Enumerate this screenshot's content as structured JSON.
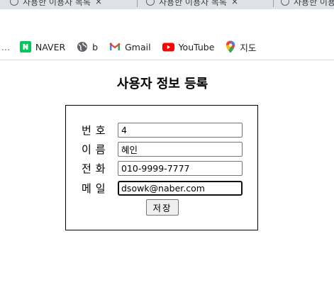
{
  "browser": {
    "tabs": [
      {
        "title": "사용한 이용자 목록"
      },
      {
        "title": "사용한 이용자 목록"
      },
      {
        "title": "사용한 이용자 목록"
      }
    ],
    "tab_close_glyph": "×",
    "bookmarks_overflow": "...",
    "bookmarks": [
      {
        "label": "NAVER",
        "icon": "naver-icon"
      },
      {
        "label": "b",
        "icon": "globe-icon"
      },
      {
        "label": "Gmail",
        "icon": "gmail-icon"
      },
      {
        "label": "YouTube",
        "icon": "youtube-icon"
      },
      {
        "label": "지도",
        "icon": "maps-icon"
      }
    ]
  },
  "page": {
    "title": "사용자 정보 등록",
    "form": {
      "fields": [
        {
          "label": "번호",
          "value": "4"
        },
        {
          "label": "이름",
          "value": "혜인"
        },
        {
          "label": "전화",
          "value": "010-9999-7777"
        },
        {
          "label": "메일",
          "value": "dsowk@naber.com"
        }
      ],
      "save_label": "저장"
    }
  },
  "colors": {
    "tabstrip": "#dee1e6",
    "naver_green": "#03c75a",
    "youtube_red": "#ff0000",
    "gmail_red": "#ea4335"
  }
}
